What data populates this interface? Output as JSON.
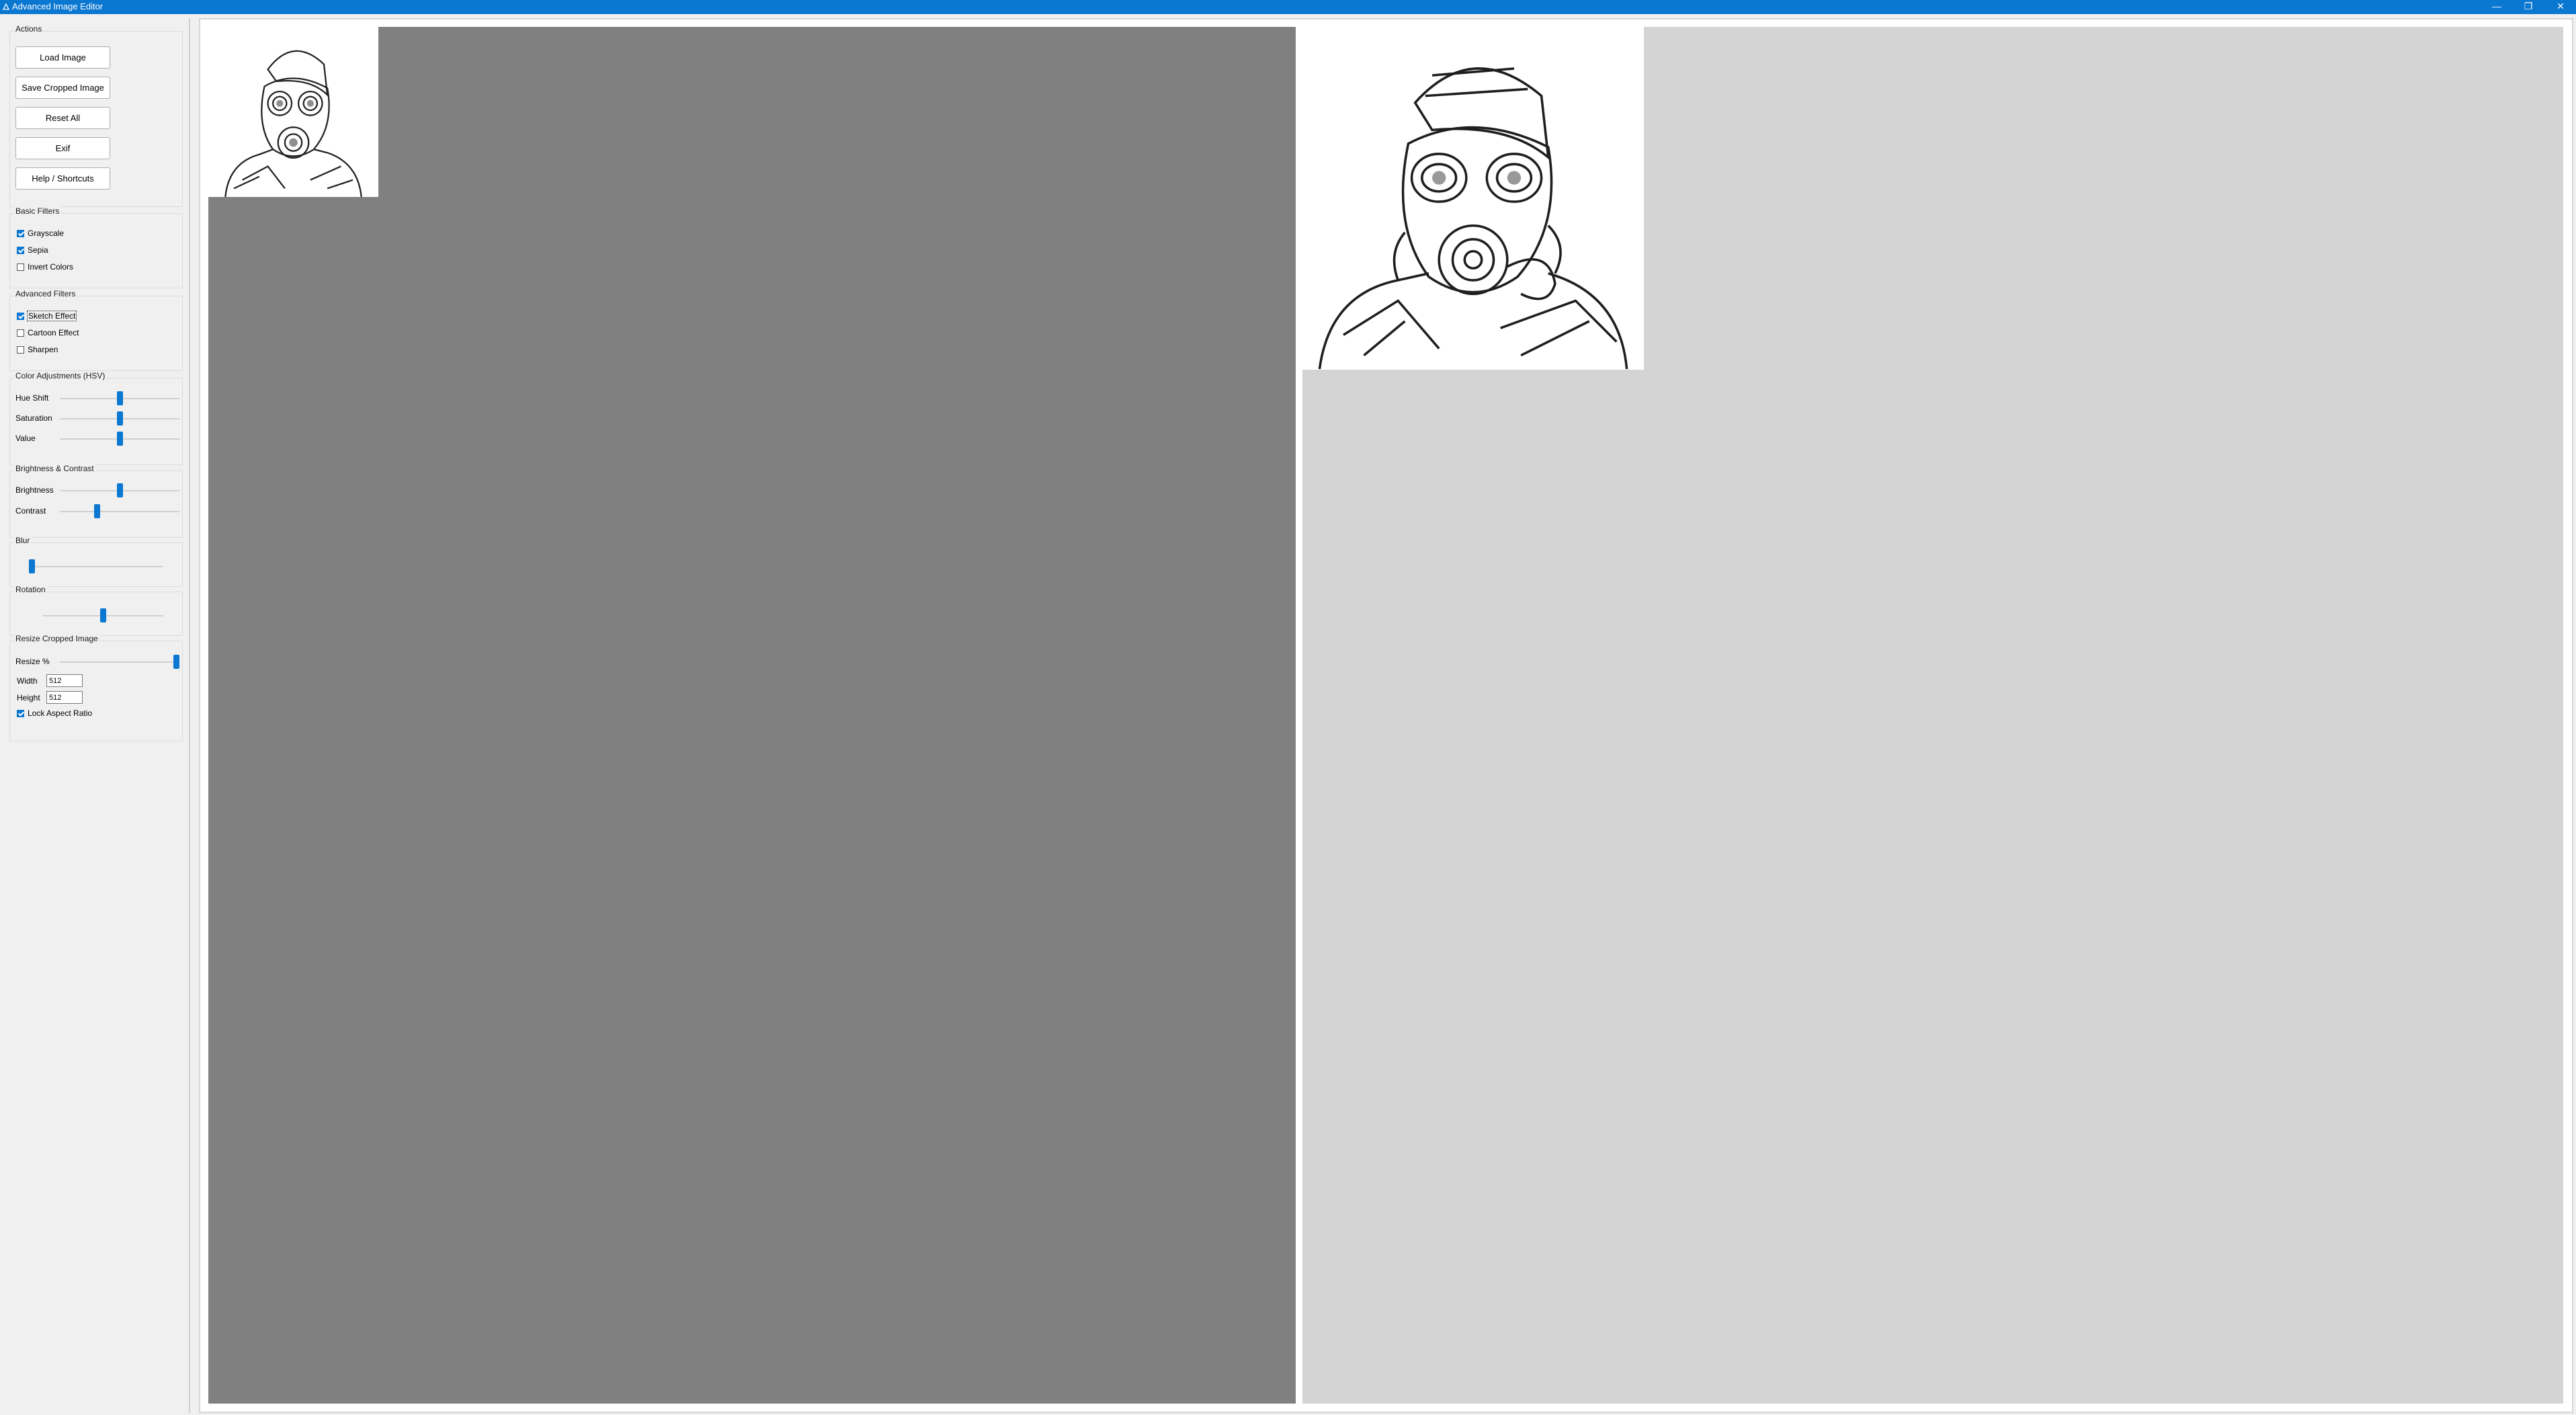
{
  "window": {
    "title": "Advanced Image Editor",
    "controls": {
      "minimize": "—",
      "maximize": "❐",
      "close": "✕"
    },
    "accent_color": "#0a77d1"
  },
  "actions": {
    "title": "Actions",
    "buttons": {
      "load": "Load Image",
      "save": "Save Cropped Image",
      "reset": "Reset All",
      "exif": "Exif",
      "help": "Help / Shortcuts"
    }
  },
  "basic_filters": {
    "title": "Basic Filters",
    "grayscale": {
      "label": "Grayscale",
      "checked": true
    },
    "sepia": {
      "label": "Sepia",
      "checked": true
    },
    "invert": {
      "label": "Invert Colors",
      "checked": false
    }
  },
  "advanced_filters": {
    "title": "Advanced Filters",
    "sketch": {
      "label": "Sketch Effect",
      "checked": true
    },
    "cartoon": {
      "label": "Cartoon Effect",
      "checked": false
    },
    "sharpen": {
      "label": "Sharpen",
      "checked": false
    }
  },
  "color_adjustments": {
    "title": "Color Adjustments (HSV)",
    "hue": {
      "label": "Hue Shift",
      "fraction": 0.5
    },
    "saturation": {
      "label": "Saturation",
      "fraction": 0.5
    },
    "value": {
      "label": "Value",
      "fraction": 0.5
    }
  },
  "brightness_contrast": {
    "title": "Brightness & Contrast",
    "brightness": {
      "label": "Brightness",
      "fraction": 0.5
    },
    "contrast": {
      "label": "Contrast",
      "fraction": 0.3
    }
  },
  "blur": {
    "title": "Blur",
    "fraction": 0.0
  },
  "rotation": {
    "title": "Rotation",
    "fraction": 0.5
  },
  "resize": {
    "title": "Resize Cropped Image",
    "resize_label": "Resize %",
    "fraction": 1.0,
    "width_label": "Width",
    "width_value": "512",
    "height_label": "Height",
    "height_value": "512",
    "lock": {
      "label": "Lock Aspect Ratio",
      "checked": true
    }
  },
  "canvas": {
    "original_background": "#808080",
    "result_background": "#d4d4d4",
    "image_subject": "sketch of soldier wearing a gas mask"
  }
}
